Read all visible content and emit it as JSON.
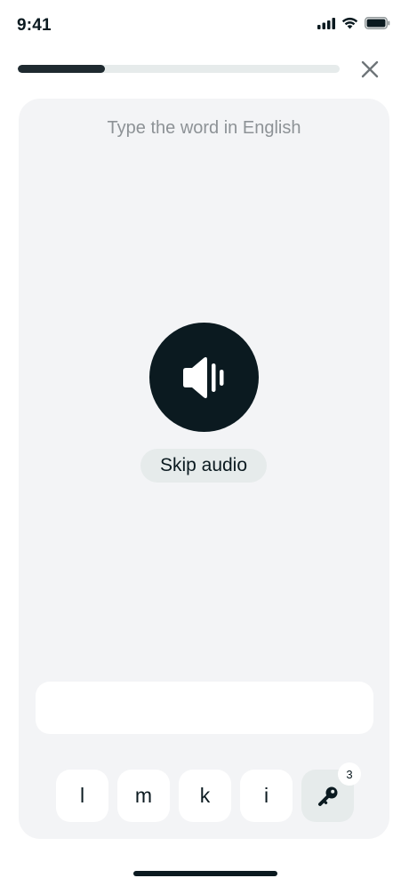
{
  "status_bar": {
    "time": "9:41",
    "icons": [
      "cellular-signal-icon",
      "wifi-icon",
      "battery-icon"
    ]
  },
  "header": {
    "progress_fraction": 0.27,
    "close_icon": "close-icon"
  },
  "exercise": {
    "prompt": "Type the word in English",
    "audio_icon": "speaker-icon",
    "skip_label": "Skip audio",
    "answer_value": "",
    "letter_keys": [
      "l",
      "m",
      "k",
      "i"
    ],
    "hint_icon": "key-icon",
    "hint_count": "3"
  },
  "colors": {
    "dark": "#0b1a20",
    "card_bg": "#f3f4f6",
    "chip_bg": "#e6ebeb",
    "prompt_text": "#8d9296"
  }
}
